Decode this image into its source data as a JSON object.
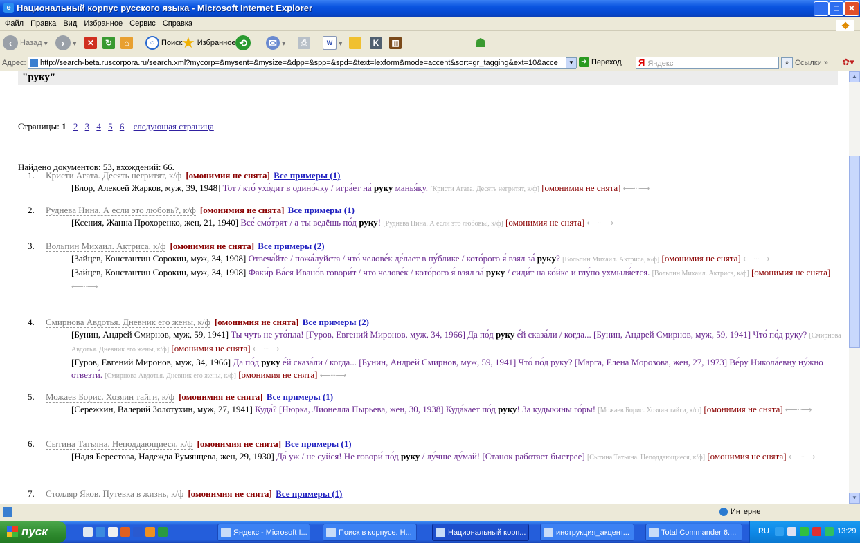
{
  "window": {
    "title": "Национальный корпус русского языка - Microsoft Internet Explorer"
  },
  "menu": [
    "Файл",
    "Правка",
    "Вид",
    "Избранное",
    "Сервис",
    "Справка"
  ],
  "toolbar": {
    "back": "Назад",
    "search": "Поиск",
    "favorites": "Избранное"
  },
  "addressbar": {
    "label": "Адрес:",
    "url": "http://search-beta.ruscorpora.ru/search.xml?mycorp=&mysent=&mysize=&dpp=&spp=&spd=&text=lexform&mode=accent&sort=gr_tagging&ext=10&acce",
    "go": "Переход",
    "yandex_placeholder": "Яндекс",
    "links": "Ссылки"
  },
  "content": {
    "query": "\"руку\"",
    "pages_label": "Страницы:",
    "current_page": "1",
    "pages": [
      "2",
      "3",
      "4",
      "5",
      "6"
    ],
    "next_page": "следующая страница",
    "found": "Найдено документов: 53, вхождений: 66.",
    "homonymy": "[омонимия не снята]",
    "arrows": "⟵···⟶",
    "documents": [
      {
        "num": "1.",
        "title": "Кристи Агата. Десять негритят, к/ф",
        "all": "Все примеры (1)",
        "examples": [
          {
            "meta": "[Блор, Алексей Жарков, муж, 39, 1948]",
            "pre": "Тот / кто́ ухо́дит в одино́чку / игра́ет на́",
            "hit": "руку",
            "post": "манья́ку.",
            "src": "[Кристи Агата. Десять негритят, к/ф]"
          }
        ]
      },
      {
        "num": "2.",
        "title": "Руднева Нина. А если это любовь?, к/ф",
        "all": "Все примеры (1)",
        "examples": [
          {
            "meta": "[Ксения, Жанна Прохоренко, жен, 21, 1940]",
            "pre": "Все́ смо́трят / а ты ведёшь по́д",
            "hit": "руку",
            "post": "!",
            "src": "[Руднева Нина. А если это любовь?, к/ф]"
          }
        ]
      },
      {
        "num": "3.",
        "title": "Вольпин Михаил. Актриса, к/ф",
        "all": "Все примеры (2)",
        "examples": [
          {
            "meta": "[Зайцев, Константин Сорокин, муж, 34, 1908]",
            "pre": "Отвеча́йте / пожа́луйста / что́ челове́к де́лает в пу́блике / кото́рого я́ взял за́",
            "hit": "руку",
            "post": "?",
            "src": "[Вольпин Михаил. Актриса, к/ф]"
          },
          {
            "meta": "[Зайцев, Константин Сорокин, муж, 34, 1908]",
            "pre": "Факи́р Ва́ся Ивано́в говори́т / что челове́к / кото́рого я́ взял за́",
            "hit": "руку",
            "post": "/ сиди́т на ко́йке и глу́по ухмыля́ется.",
            "src": "[Вольпин Михаил. Актриса, к/ф]"
          }
        ]
      },
      {
        "num": "4.",
        "title": "Смирнова Авдотья. Дневник его жены, к/ф",
        "all": "Все примеры (2)",
        "examples": [
          {
            "meta": "[Бунин, Андрей Смирнов, муж, 59, 1941]",
            "pre": "Ты чуть не уто́пла! [Гуров, Евгений Миронов, муж, 34, 1966] Да по́д",
            "hit": "руку",
            "post": "е́й сказа́ли / когда... [Бунин, Андрей Смирнов, муж, 59, 1941] Что́ по́д руку?",
            "src": "[Смирнова Авдотья. Дневник его жены, к/ф]"
          },
          {
            "meta": "[Гуров, Евгений Миронов, муж, 34, 1966]",
            "pre": "Да по́д",
            "hit": "руку",
            "post": "е́й сказа́ли / когда... [Бунин, Андрей Смирнов, муж, 59, 1941] Что́ по́д руку? [Марга, Елена Морозова, жен, 27, 1973] Ве́ру Никола́евну ну́жно отвезти́.",
            "src": "[Смирнова Авдотья. Дневник его жены, к/ф]"
          }
        ]
      },
      {
        "num": "5.",
        "title": "Можаев Борис. Хозяин тайги, к/ф",
        "all": "Все примеры (1)",
        "examples": [
          {
            "meta": "[Сережкин, Валерий Золотухин, муж, 27, 1941]",
            "pre": "Куда́? [Нюрка, Лионелла Пырьева, жен, 30, 1938] Куда́кает по́д",
            "hit": "руку",
            "post": "! За кудыкины го́ры!",
            "src": "[Можаев Борис. Хозяин тайги, к/ф]"
          }
        ]
      },
      {
        "num": "6.",
        "title": "Сытина Татьяна. Неподдающиеся, к/ф",
        "all": "Все примеры (1)",
        "examples": [
          {
            "meta": "[Надя Берестова, Надежда Румянцева, жен, 29, 1930]",
            "pre": "Да́ уж / не суйся! Не говори́ по́д",
            "hit": "руку",
            "post": "/ лу́чше ду́май! [Станок работает быстрее]",
            "src": "[Сытина Татьяна. Неподдающиеся, к/ф]"
          }
        ]
      },
      {
        "num": "7.",
        "title": "Столляр Яков. Путевка в жизнь, к/ф",
        "all": "Все примеры (1)",
        "examples": []
      }
    ]
  },
  "statusbar": {
    "zone": "Интернет"
  },
  "taskbar": {
    "start": "пуск",
    "tasks": [
      "Яндекс - Microsoft I...",
      "Поиск в корпусе. Н...",
      "Национальный корп...",
      "инструкция_акцент...",
      "Total Commander 6...."
    ],
    "lang": "RU",
    "clock": "13:29"
  }
}
